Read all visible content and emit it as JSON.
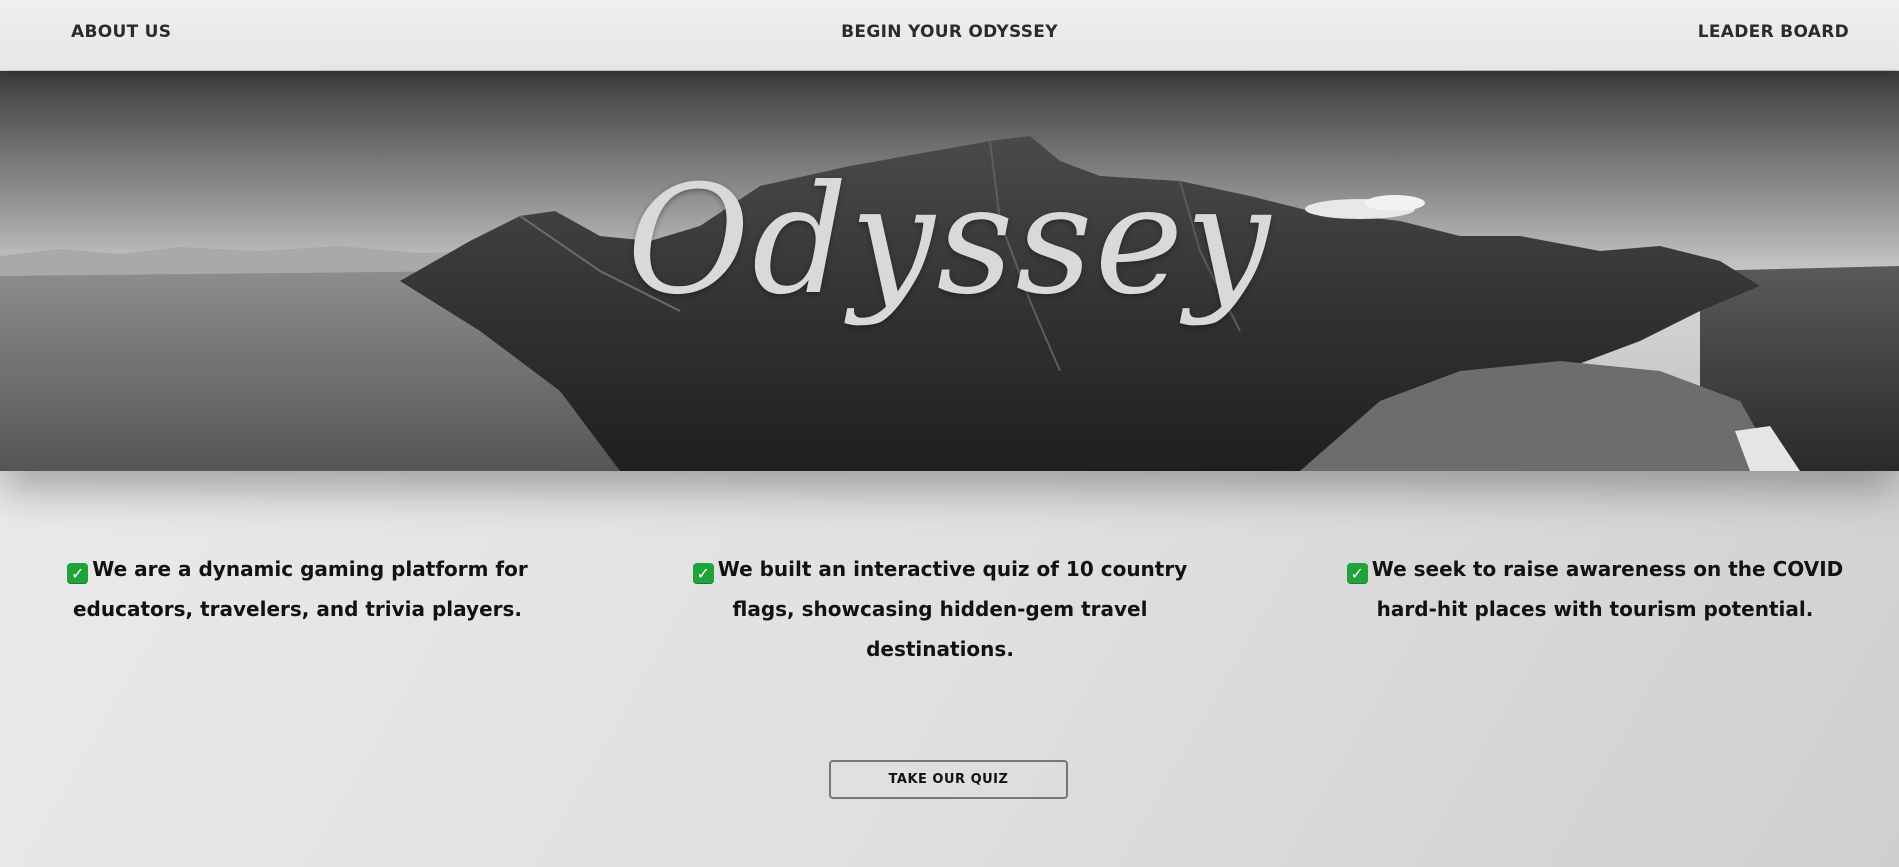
{
  "nav": {
    "about": "ABOUT US",
    "begin": "BEGIN YOUR ODYSSEY",
    "leaderboard": "LEADER BOARD"
  },
  "hero": {
    "title": "Odyssey"
  },
  "features": [
    {
      "icon": "check-mark-icon",
      "text": "We are a dynamic gaming platform for educators, travelers, and trivia players."
    },
    {
      "icon": "check-mark-icon",
      "text": "We built an interactive quiz of 10 country flags, showcasing hidden-gem travel destinations."
    },
    {
      "icon": "check-mark-icon",
      "text": "We seek to raise awareness on the COVID hard-hit places with tourism potential."
    }
  ],
  "cta": {
    "label": "TAKE OUR QUIZ"
  },
  "colors": {
    "check": "#20a33a",
    "hero_title": "#d9d9d9"
  }
}
